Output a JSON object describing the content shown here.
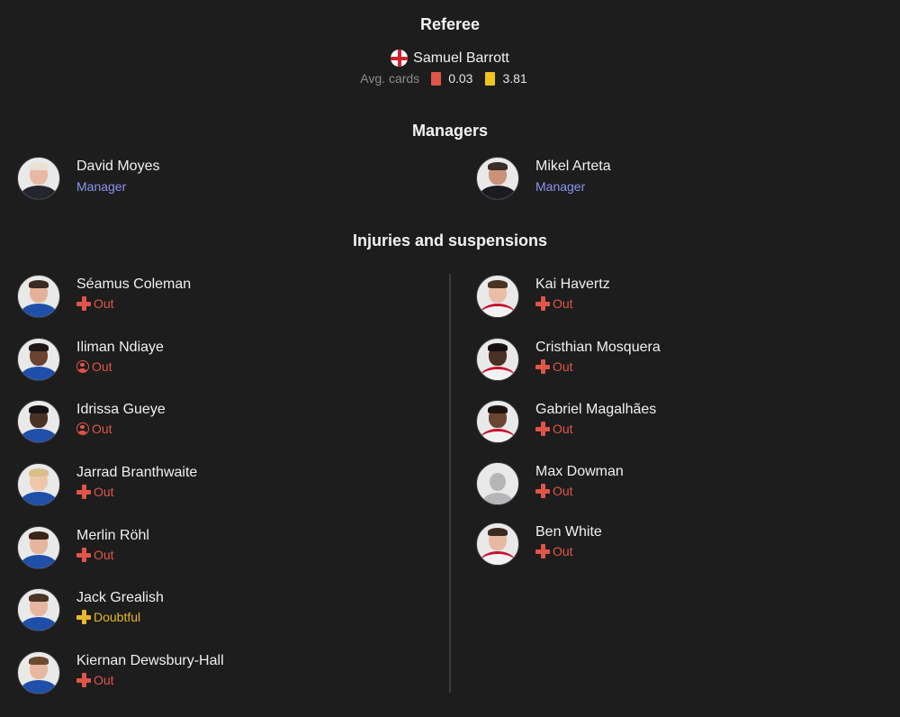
{
  "referee": {
    "title": "Referee",
    "name": "Samuel Barrott",
    "flag_icon": "england-flag-icon",
    "avg_cards_label": "Avg. cards",
    "red_avg": "0.03",
    "yellow_avg": "3.81",
    "red_color": "#e0554a",
    "yellow_color": "#f0c419"
  },
  "managers": {
    "title": "Managers",
    "home": {
      "name": "David Moyes",
      "role": "Manager"
    },
    "away": {
      "name": "Mikel Arteta",
      "role": "Manager"
    }
  },
  "injuries": {
    "title": "Injuries and suspensions",
    "home": [
      {
        "name": "Séamus Coleman",
        "status": "Out",
        "icon": "injury-cross-icon"
      },
      {
        "name": "Iliman Ndiaye",
        "status": "Out",
        "icon": "suspension-icon"
      },
      {
        "name": "Idrissa Gueye",
        "status": "Out",
        "icon": "suspension-icon"
      },
      {
        "name": "Jarrad Branthwaite",
        "status": "Out",
        "icon": "injury-cross-icon"
      },
      {
        "name": "Merlin Röhl",
        "status": "Out",
        "icon": "injury-cross-icon"
      },
      {
        "name": "Jack Grealish",
        "status": "Doubtful",
        "icon": "injury-cross-icon"
      },
      {
        "name": "Kiernan Dewsbury-Hall",
        "status": "Out",
        "icon": "injury-cross-icon"
      }
    ],
    "away": [
      {
        "name": "Kai Havertz",
        "status": "Out",
        "icon": "injury-cross-icon"
      },
      {
        "name": "Cristhian Mosquera",
        "status": "Out",
        "icon": "injury-cross-icon"
      },
      {
        "name": "Gabriel Magalhães",
        "status": "Out",
        "icon": "injury-cross-icon"
      },
      {
        "name": "Max Dowman",
        "status": "Out",
        "icon": "injury-cross-icon"
      },
      {
        "name": "Ben White",
        "status": "Out",
        "icon": "injury-cross-icon"
      }
    ]
  },
  "colors": {
    "background": "#1d1d1d",
    "manager_role": "#8a93f0",
    "out": "#e0554a",
    "doubtful": "#e9b82a",
    "home_kit": "#1f4fa8",
    "away_kit": "#f2f2f2"
  }
}
